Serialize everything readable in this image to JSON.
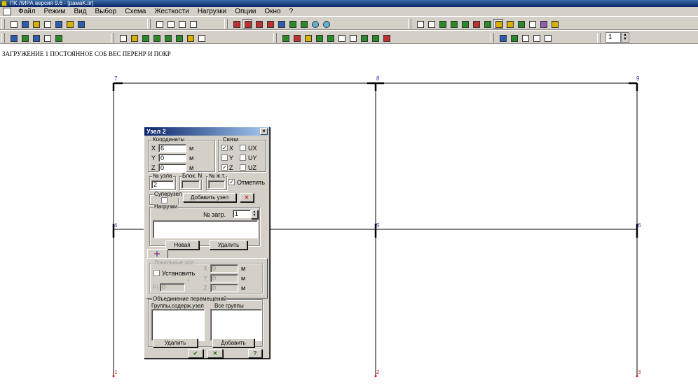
{
  "window": {
    "title": "ПК ЛИРА  версия 9.6 - [рамаK.lir]"
  },
  "menu": [
    "Файл",
    "Режим",
    "Вид",
    "Выбор",
    "Схема",
    "Жесткости",
    "Нагрузки",
    "Опции",
    "Окно",
    "?"
  ],
  "toolbar": {
    "load_number": "1"
  },
  "canvas": {
    "caption": "ЗАГРУЖЕНИЕ 1 ПОСТОЯННОЕ СОБ ВЕС ПЕРЕНР И ПОКР",
    "nodes": [
      {
        "id": "1",
        "color": "red"
      },
      {
        "id": "2",
        "color": "red"
      },
      {
        "id": "3",
        "color": "red"
      },
      {
        "id": "4",
        "color": "blue"
      },
      {
        "id": "5",
        "color": "blue"
      },
      {
        "id": "6",
        "color": "blue"
      },
      {
        "id": "7",
        "color": "blue"
      },
      {
        "id": "8",
        "color": "blue"
      },
      {
        "id": "9",
        "color": "blue"
      }
    ]
  },
  "dialog": {
    "title": "Узел 2",
    "close": "×",
    "coords": {
      "title": "Координаты",
      "x_label": "X",
      "x_value": "6",
      "y_label": "Y",
      "y_value": "0",
      "z_label": "Z",
      "z_value": "0",
      "unit": "м"
    },
    "links": {
      "title": "Связи",
      "x": {
        "label": "X",
        "checked": "✓"
      },
      "ux": {
        "label": "UX",
        "checked": ""
      },
      "y": {
        "label": "Y",
        "checked": ""
      },
      "uy": {
        "label": "UY",
        "checked": ""
      },
      "z": {
        "label": "Z",
        "checked": "✓"
      },
      "uz": {
        "label": "UZ",
        "checked": ""
      }
    },
    "node_no": {
      "title": "№ узла",
      "value": "2"
    },
    "block_no": {
      "title": "Блок. N",
      "value": ""
    },
    "rigid_no": {
      "title": "№ ж.т.",
      "value": ""
    },
    "mark": {
      "label": "Отметить",
      "checked": "✓"
    },
    "supernode": {
      "title": "Суперузел",
      "checked": ""
    },
    "add_node_button": "Добавить узел",
    "loads": {
      "title": "Нагрузки",
      "load_no_label": "№ загр.",
      "load_no_value": "1",
      "new_button": "Новая",
      "delete_button": "Удалить"
    },
    "local_axes": {
      "title": "Локальные оси",
      "set_label": "Установить",
      "fi_label": "Fi",
      "fi_value": "0",
      "fi_unit": "°",
      "x_label": "X",
      "x_value": "0",
      "y_label": "Y",
      "y_value": "0",
      "z_label": "Z",
      "z_value": "0",
      "unit": "м"
    },
    "merge": {
      "title": "Объединение перемещений",
      "groups_with_node": "Группы,содерж.узел",
      "all_groups": "Все группы",
      "delete_button": "Удалить",
      "add_button": "Добавить"
    },
    "footer": {
      "ok_icon": "check-icon",
      "cancel_icon": "cross-icon",
      "help": "?"
    }
  }
}
